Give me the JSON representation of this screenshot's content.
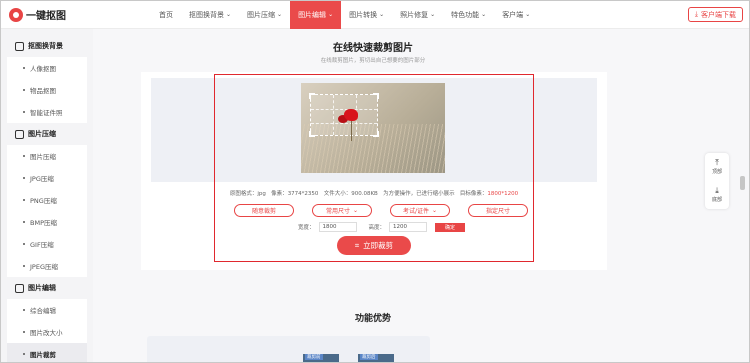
{
  "brand": {
    "name": "一键抠图",
    "accent": "#e84545"
  },
  "nav": {
    "items": [
      {
        "label": "首页",
        "caret": false,
        "active": false
      },
      {
        "label": "抠图换背景",
        "caret": true,
        "active": false
      },
      {
        "label": "图片压缩",
        "caret": true,
        "active": false
      },
      {
        "label": "图片编辑",
        "caret": true,
        "active": true
      },
      {
        "label": "图片转换",
        "caret": true,
        "active": false
      },
      {
        "label": "照片修复",
        "caret": true,
        "active": false
      },
      {
        "label": "特色功能",
        "caret": true,
        "active": false
      },
      {
        "label": "客户端",
        "caret": true,
        "active": false
      }
    ],
    "download_label": "客户端下载"
  },
  "sidebar": {
    "groups": [
      {
        "title": "抠图换背景",
        "icon": "cutout-icon",
        "items": [
          "人像抠图",
          "物品抠图",
          "智能证件照"
        ]
      },
      {
        "title": "图片压缩",
        "icon": "compress-icon",
        "items": [
          "图片压缩",
          "JPG压缩",
          "PNG压缩",
          "BMP压缩",
          "GIF压缩",
          "JPEG压缩"
        ]
      },
      {
        "title": "图片编辑",
        "icon": "edit-icon",
        "items": [
          "综合编辑",
          "图片改大小",
          "图片裁剪"
        ]
      }
    ],
    "active_item": "图片裁剪"
  },
  "main": {
    "title": "在线快速裁剪图片",
    "subtitle": "在线裁剪图片，剪切出自己想要的图片部分",
    "info": {
      "format_label": "原图格式：",
      "format": "jpg",
      "pixels_label": "像素：",
      "pixels": "3774*2350",
      "size_label": "文件大小：",
      "size": "900.08KB",
      "note": "为方便操作，已进行缩小展示",
      "target_label": "目标像素：",
      "target": "1800*1200"
    },
    "options": [
      "随意裁剪",
      "常用尺寸",
      "考试/证件",
      "指定尺寸"
    ],
    "width_label": "宽度：",
    "width_value": "1800",
    "height_label": "高度：",
    "height_value": "1200",
    "confirm_label": "确定",
    "crop_button": "立即裁剪",
    "section_title": "功能优势",
    "thumb_labels": [
      "裁剪前",
      "裁剪后"
    ]
  },
  "floatbar": {
    "top_label": "顶部",
    "bottom_label": "底部"
  }
}
